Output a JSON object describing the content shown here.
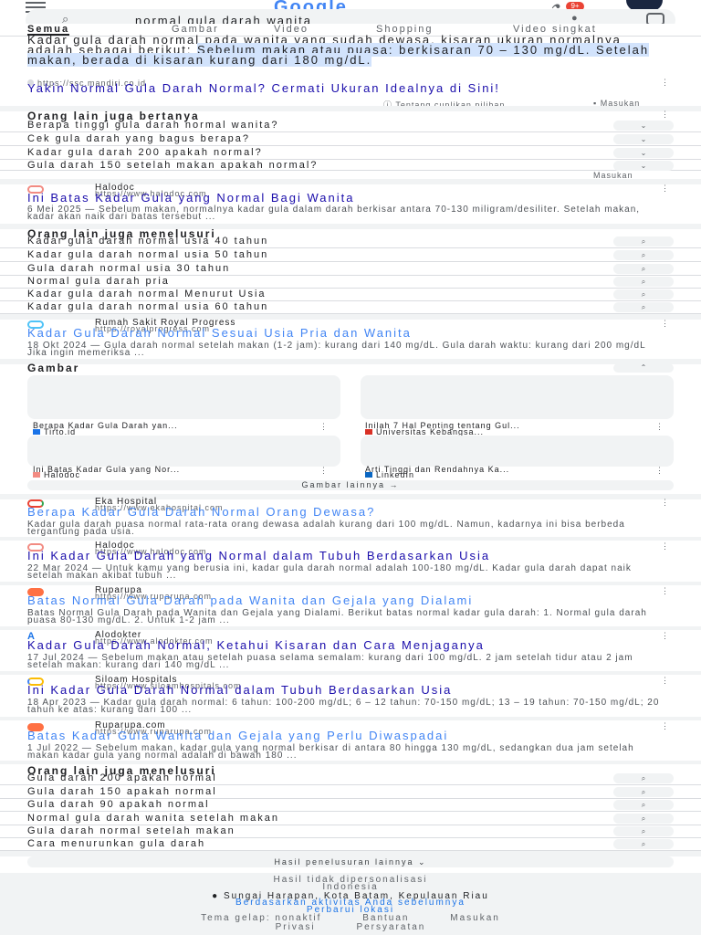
{
  "header": {
    "logo": "Google",
    "notification_count": "9+",
    "search_query": "normal gula darah wanita",
    "tabs": [
      "Semua",
      "Gambar",
      "Video",
      "Shopping",
      "Video singkat"
    ]
  },
  "featured": {
    "snippet_plain": "Kadar gula darah normal pada wanita yang sudah dewasa, kisaran ukuran normalnya adalah sebagai berikut: ",
    "snippet_highlight": "Sebelum makan atau puasa: berkisaran 70 – 130 mg/dL. Setelah makan, berada di kisaran kurang dari 180 mg/dL.",
    "source_url": "https://ssc.mandiri.co.id",
    "title": "Yakin Normal Gula Darah Normal? Cermati Ukuran Idealnya di Sini!",
    "meta": "Tentang cuplikan pilihan",
    "feedback": "Masukan"
  },
  "paa": {
    "heading": "Orang lain juga bertanya",
    "questions": [
      "Berapa tinggi gula darah normal wanita?",
      "Cek gula darah yang bagus berapa?",
      "Kadar gula darah 200 apakah normal?",
      "Gula darah 150 setelah makan apakah normal?"
    ],
    "feedback": "Masukan"
  },
  "result1": {
    "site": "Halodoc",
    "url": "https://www.halodoc.com",
    "title": "Ini Batas Kadar Gula yang Normal Bagi Wanita",
    "snippet": "6 Mei 2025 — Sebelum makan, normalnya kadar gula dalam darah berkisar antara 70-130 miligram/desiliter. Setelah makan, kadar akan naik dari batas tersebut ..."
  },
  "related1": {
    "heading": "Orang lain juga menelusuri",
    "items": [
      "Kadar gula darah normal usia 40 tahun",
      "Kadar gula darah normal usia 50 tahun",
      "Gula darah normal usia 30 tahun",
      "Normal gula darah pria",
      "Kadar gula darah normal Menurut Usia",
      "Kadar gula darah normal usia 60 tahun"
    ]
  },
  "result2": {
    "site": "Rumah Sakit Royal Progress",
    "url": "https://royalprogress.com",
    "title": "Kadar Gula Darah Normal Sesuai Usia Pria dan Wanita",
    "snippet": "18 Okt 2024 — Gula darah normal setelah makan (1-2 jam): kurang dari 140 mg/dL. Gula darah waktu: kurang dari 200 mg/dL Jika ingin memeriksa ..."
  },
  "images": {
    "heading": "Gambar",
    "captions": [
      "Berapa Kadar Gula Darah yan...",
      "Inilah 7 Hal Penting tentang Gul...",
      "Ini Batas Kadar Gula yang Nor...",
      "Arti Tinggi dan Rendahnya Ka..."
    ],
    "sources": [
      "Tirto.id",
      "Universitas Kebangsa...",
      "Halodoc",
      "LinkedIn"
    ],
    "more_label": "Gambar lainnya"
  },
  "results": [
    {
      "site": "Eka Hospital",
      "url": "https://www.ekahospital.com",
      "title": "Berapa Kadar Gula Darah Normal Orang Dewasa?",
      "snippet": "Kadar gula darah puasa normal rata-rata orang dewasa adalah kurang dari 100 mg/dL. Namun, kadarnya ini bisa berbeda tergantung pada usia."
    },
    {
      "site": "Halodoc",
      "url": "https://www.halodoc.com",
      "title": "Ini Kadar Gula Darah yang Normal dalam Tubuh Berdasarkan Usia",
      "snippet": "22 Mar 2024 — Untuk kamu yang berusia ini, kadar gula darah normal adalah 100-180 mg/dL. Kadar gula darah dapat naik setelah makan akibat tubuh ..."
    },
    {
      "site": "Ruparupa",
      "url": "https://www.ruparupa.com",
      "title": "Batas Normal Gula Darah pada Wanita dan Gejala yang Dialami",
      "snippet": "Batas Normal Gula Darah pada Wanita dan Gejala yang Dialami. Berikut batas normal kadar gula darah: 1. Normal gula darah puasa 80-130 mg/dL. 2. Untuk 1-2 jam ..."
    },
    {
      "site": "Alodokter",
      "url": "https://www.alodokter.com",
      "title": "Kadar Gula Darah Normal, Ketahui Kisaran dan Cara Menjaganya",
      "snippet": "17 Jul 2024 — Sebelum makan atau setelah puasa selama semalam: kurang dari 100 mg/dL. 2 jam setelah tidur atau 2 jam setelah makan: kurang dari 140 mg/dL ..."
    },
    {
      "site": "Siloam Hospitals",
      "url": "https://www.siloamhospitals.com",
      "title": "Ini Kadar Gula Darah Normal dalam Tubuh Berdasarkan Usia",
      "snippet": "18 Apr 2023 — Kadar gula darah normal: 6 tahun: 100-200 mg/dL; 6 – 12 tahun: 70-150 mg/dL; 13 – 19 tahun: 70-150 mg/dL; 20 tahun ke atas: kurang dari 100 ..."
    },
    {
      "site": "Ruparupa.com",
      "url": "https://www.ruparupa.com",
      "title": "Batas Kadar Gula Wanita dan Gejala yang Perlu Diwaspadai",
      "snippet": "1 Jul 2022 — Sebelum makan, kadar gula yang normal berkisar di antara 80 hingga 130 mg/dL, sedangkan dua jam setelah makan kadar gula yang normal adalah di bawah 180 ..."
    }
  ],
  "related2": {
    "heading": "Orang lain juga menelusuri",
    "items": [
      "Gula darah 200 apakah normal",
      "Gula darah 150 apakah normal",
      "Gula darah 90 apakah normal",
      "Normal gula darah wanita setelah makan",
      "Gula darah normal setelah makan",
      "Cara menurunkan gula darah"
    ]
  },
  "more_results": "Hasil penelusuran lainnya",
  "footer": {
    "line1": "Hasil tidak dipersonalisasi",
    "line2": "Indonesia",
    "location": "Sungai Harapan, Kota Batam, Kepulauan Riau",
    "location_note": "Berdasarkan aktivitas Anda sebelumnya",
    "update": "Perbarui lokasi",
    "links": [
      "Tema gelap: nonaktif",
      "Bantuan",
      "Masukan"
    ],
    "links2": [
      "Privasi",
      "Persyaratan"
    ]
  },
  "colors": {
    "link": "#1a0dab",
    "highlight": "#d2e3fc",
    "accent": "#1a73e8"
  }
}
